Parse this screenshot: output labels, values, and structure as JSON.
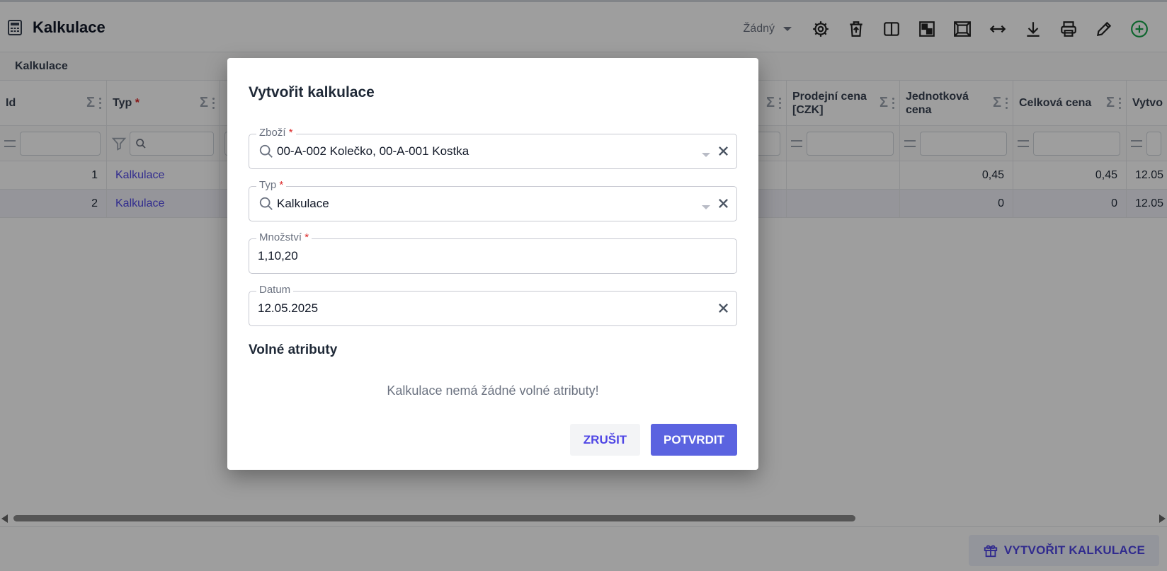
{
  "app": {
    "title": "Kalkulace",
    "breadcrumb": "Kalkulace"
  },
  "toolbar": {
    "view_select": "Žádný",
    "icons": [
      "gear-icon",
      "delete-icon",
      "columns-icon",
      "grid-icon",
      "fit-icon",
      "resize-icon",
      "download-icon",
      "print-icon",
      "edit-icon",
      "add-icon"
    ]
  },
  "grid": {
    "columns": [
      {
        "label": "Id",
        "required": false
      },
      {
        "label": "Typ",
        "required": true
      },
      {
        "label": "",
        "required": false
      },
      {
        "label": "Prodejní cena [CZK]",
        "required": false
      },
      {
        "label": "Jednotková cena",
        "required": false
      },
      {
        "label": "Celková cena",
        "required": false
      },
      {
        "label": "Vytvo",
        "required": false
      }
    ],
    "rows": [
      {
        "id": "1",
        "typ": "Kalkulace",
        "prodejni": "",
        "jednotkova": "0,45",
        "celkova": "0,45",
        "vytvoreno": "12.05"
      },
      {
        "id": "2",
        "typ": "Kalkulace",
        "prodejni": "",
        "jednotkova": "0",
        "celkova": "0",
        "vytvoreno": "12.05"
      }
    ]
  },
  "footer": {
    "create_label": "VYTVOŘIT KALKULACE"
  },
  "dialog": {
    "title": "Vytvořit kalkulace",
    "fields": {
      "zbozi": {
        "label": "Zboží",
        "value": "00-A-002 Kolečko, 00-A-001 Kostka",
        "required": true
      },
      "typ": {
        "label": "Typ",
        "value": "Kalkulace",
        "required": true
      },
      "mnozstvi": {
        "label": "Množství",
        "value": "1,10,20",
        "required": true
      },
      "datum": {
        "label": "Datum",
        "value": "12.05.2025",
        "required": false
      }
    },
    "section_title": "Volné atributy",
    "empty_message": "Kalkulace nemá žádné volné atributy!",
    "cancel_label": "ZRUŠIT",
    "confirm_label": "POTVRDIT"
  },
  "colors": {
    "accent": "#5b63e0",
    "link": "#4f46e5",
    "required": "#dc2626",
    "add_icon": "#16a34a"
  }
}
